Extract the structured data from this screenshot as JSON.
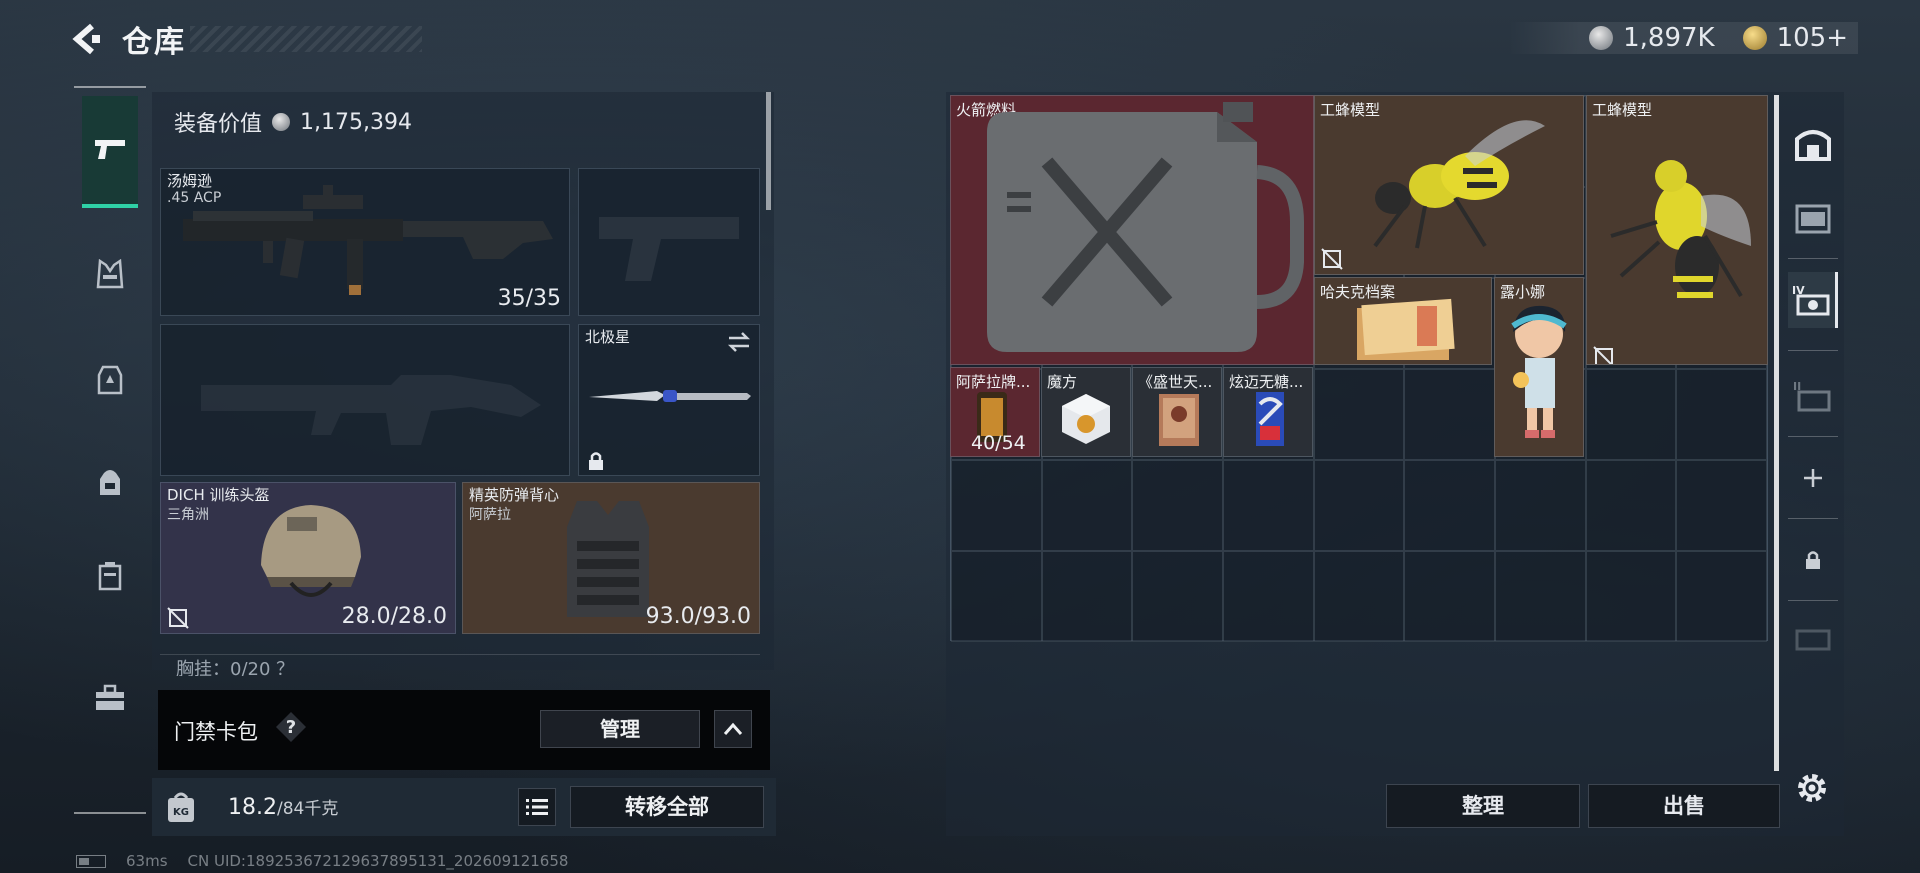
{
  "header": {
    "title": "仓库",
    "currency_silver": "1,897K",
    "currency_gold": "105+"
  },
  "loadout": {
    "equip_value_label": "装备价值",
    "equip_value": "1,175,394",
    "primary": {
      "name": "汤姆逊",
      "ammo": ".45 ACP",
      "count": "35/35"
    },
    "melee": {
      "name": "北极星"
    },
    "helmet": {
      "name": "DICH 训练头盔",
      "sub": "三角洲",
      "durability": "28.0/28.0"
    },
    "armor": {
      "name": "精英防弹背心",
      "sub": "阿萨拉",
      "durability": "93.0/93.0"
    },
    "next_row": "胸挂：0/20 ？"
  },
  "keycard": {
    "label": "门禁卡包",
    "help": "?",
    "manage": "管理"
  },
  "weight": {
    "current": "18.2",
    "max": "/84千克",
    "transfer_all": "转移全部",
    "kg_badge": "KG"
  },
  "status": {
    "ping": "63ms",
    "uid": "CN UID:1892536721296378951​31_202609121658"
  },
  "stash": {
    "items": [
      {
        "name": "火箭燃料",
        "color": "red"
      },
      {
        "name": "工蜂模型",
        "color": "brown"
      },
      {
        "name": "工蜂模型",
        "color": "brown"
      },
      {
        "name": "哈夫克档案",
        "color": "brown"
      },
      {
        "name": "露小娜",
        "color": "brown"
      },
      {
        "name": "阿萨拉牌...",
        "color": "red",
        "count": "40/54"
      },
      {
        "name": "魔方",
        "color": "red"
      },
      {
        "name": "《盛世天...",
        "color": "red"
      },
      {
        "name": "炫迈无糖...",
        "color": "red"
      }
    ],
    "sort": "整理",
    "sell": "出售",
    "tabs": [
      "all-stash-tab",
      "stash-tab-1",
      "stash-tab-2",
      "stash-tab-3",
      "add-tab",
      "locked-tab",
      "locked-tab-2"
    ]
  }
}
